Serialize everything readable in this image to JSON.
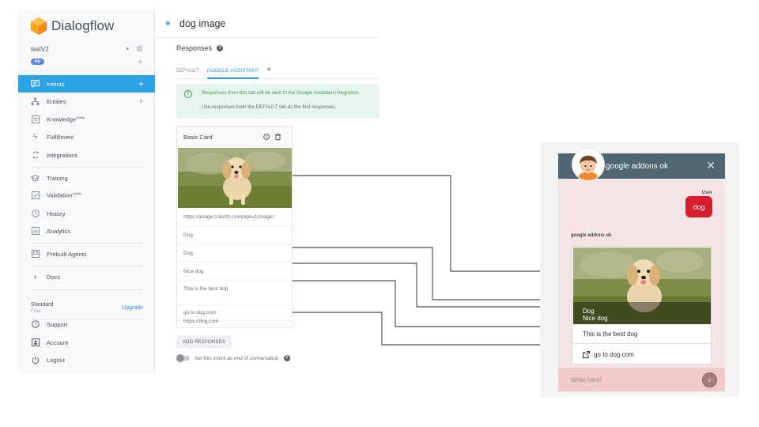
{
  "sidebar": {
    "brand": "Dialogflow",
    "agent": {
      "name": "testV2",
      "language": "es"
    },
    "nav_primary": [
      {
        "label": "Intents",
        "icon": "intents-icon",
        "suffix": "",
        "active": true,
        "plus": true
      },
      {
        "label": "Entities",
        "icon": "entities-icon",
        "suffix": "",
        "active": false,
        "plus": true
      },
      {
        "label": "Knowledge",
        "icon": "knowledge-icon",
        "suffix": "[beta]",
        "active": false,
        "plus": false
      },
      {
        "label": "Fulfillment",
        "icon": "fulfillment-icon",
        "suffix": "",
        "active": false,
        "plus": false
      },
      {
        "label": "Integrations",
        "icon": "integrations-icon",
        "suffix": "",
        "active": false,
        "plus": false
      }
    ],
    "nav_training": [
      {
        "label": "Training",
        "icon": "training-icon",
        "suffix": ""
      },
      {
        "label": "Validation",
        "icon": "validation-icon",
        "suffix": "[beta]"
      },
      {
        "label": "History",
        "icon": "history-icon",
        "suffix": ""
      },
      {
        "label": "Analytics",
        "icon": "analytics-icon",
        "suffix": ""
      }
    ],
    "prebuilt": "Prebuilt Agents",
    "docs": "Docs",
    "plan": {
      "name": "Standard",
      "tier": "Free",
      "upgrade": "Upgrade"
    },
    "nav_footer": [
      {
        "label": "Support",
        "icon": "support-icon"
      },
      {
        "label": "Account",
        "icon": "account-icon"
      },
      {
        "label": "Logout",
        "icon": "logout-icon"
      }
    ]
  },
  "intent": {
    "title": "dog image",
    "responses_label": "Responses",
    "tabs": [
      "DEFAULT",
      "GOOGLE ASSISTANT"
    ],
    "active_tab": "GOOGLE ASSISTANT",
    "info": {
      "line1": "Responses from this tab will be sent to the Google Assistant integration.",
      "line2": "Use responses from the DEFAULT tab as the first responses."
    },
    "card": {
      "title": "Basic Card",
      "image_url": "https://image.cnbcfm.com/api/v1/image/",
      "title_field": "Dog",
      "subtitle_field": "Dog",
      "subtitle2_field": "Nice dog",
      "text_field": "This is the best dog",
      "button_title": "go to dog.com",
      "button_url": "https://dog.com"
    },
    "add_responses": "ADD RESPONSES",
    "end_conversation": "Set this intent as end of conversation"
  },
  "chat": {
    "header_title": "google addons ok",
    "user_label": "User",
    "user_message": "dog",
    "bot_label": "google addons ok",
    "card": {
      "title": "Dog",
      "subtitle": "Nice dog",
      "text": "This is the best dog",
      "link": "go to dog.com"
    },
    "input_placeholder": "Write here!"
  },
  "colors": {
    "accent": "#2ea3e6",
    "chat_header": "#4f6773",
    "user_bubble": "#d81e2c",
    "chat_bg": "#f4e4e4",
    "info_green": "#3f9b59"
  }
}
